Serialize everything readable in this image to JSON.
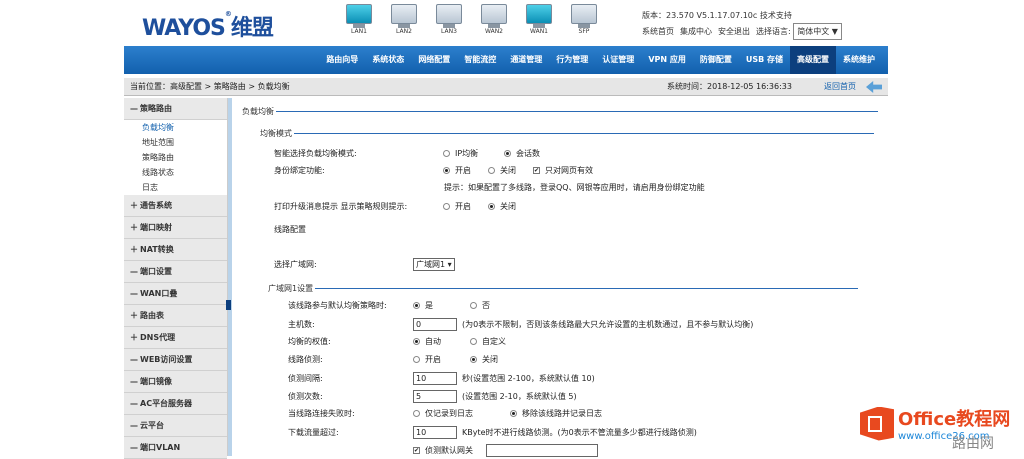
{
  "header": {
    "logo": "WAYOS",
    "logo_tm": "®",
    "logo_cn": "维盟",
    "ports": [
      {
        "label": "LAN1",
        "active": true
      },
      {
        "label": "LAN2",
        "active": false
      },
      {
        "label": "LAN3",
        "active": false
      },
      {
        "label": "WAN2",
        "active": false
      },
      {
        "label": "WAN1",
        "active": true
      },
      {
        "label": "SFP",
        "active": false
      }
    ],
    "version": "版本：23.570 V5.1.17.07.10c",
    "tech_support": "技术支持",
    "links": [
      "系统首页",
      "集成中心",
      "安全退出",
      "选择语言:"
    ],
    "language": "简体中文 ▼"
  },
  "nav": {
    "items": [
      "路由向导",
      "系统状态",
      "网络配置",
      "智能流控",
      "通道管理",
      "行为管理",
      "认证管理",
      "VPN 应用",
      "防御配置",
      "USB 存储",
      "高级配置",
      "系统维护"
    ],
    "active_index": 10
  },
  "crumb": {
    "path": "当前位置：高级配置 > 策略路由 > 负载均衡",
    "time": "系统时间：2018-12-05  16:36:33",
    "back": "返回首页"
  },
  "sidebar": {
    "groups": [
      {
        "sign": "—",
        "label": "策略路由",
        "expanded": true,
        "subs": [
          "负载均衡",
          "地址范围",
          "策略路由",
          "线路状态",
          "日志"
        ]
      },
      {
        "sign": "＋",
        "label": "通告系统"
      },
      {
        "sign": "＋",
        "label": "端口映射"
      },
      {
        "sign": "＋",
        "label": "NAT转换"
      },
      {
        "sign": "—",
        "label": "端口设置"
      },
      {
        "sign": "—",
        "label": "WAN口叠"
      },
      {
        "sign": "＋",
        "label": "路由表"
      },
      {
        "sign": "＋",
        "label": "DNS代理"
      },
      {
        "sign": "—",
        "label": "WEB访问设置"
      },
      {
        "sign": "—",
        "label": "端口镜像"
      },
      {
        "sign": "—",
        "label": "AC平台服务器"
      },
      {
        "sign": "—",
        "label": "云平台"
      },
      {
        "sign": "—",
        "label": "端口VLAN"
      }
    ],
    "current_sub": "负载均衡"
  },
  "main": {
    "section_title": "负载均衡",
    "mode": {
      "legend": "均衡模式",
      "smart_label": "智能选择负载均衡模式:",
      "smart_opts": [
        "IP均衡",
        "会话数"
      ],
      "smart_selected": 1,
      "bind_label": "身份绑定功能:",
      "bind_opts": [
        "开启",
        "关闭"
      ],
      "bind_selected": 0,
      "bind_check": "只对网页有效",
      "hint": "提示：如果配置了多线路，登录QQ、网银等应用时，请启用身份绑定功能",
      "tip_label": "打印升级消息提示   显示策略规则提示:",
      "tip_opts": [
        "开启",
        "关闭"
      ],
      "tip_selected": 1,
      "line_config": "线路配置"
    },
    "select_wan_label": "选择广域网:",
    "select_wan_value": "广域网1 ▾",
    "wan": {
      "legend": "广域网1设置",
      "multi_label": "该线路参与默认均衡策略时:",
      "multi_opts": [
        "是",
        "否"
      ],
      "multi_selected": 0,
      "hosts_label": "主机数:",
      "hosts_value": "0",
      "hosts_hint": "(为0表示不限制，否则该条线路最大只允许设置的主机数通过，且不参与默认均衡)",
      "weight_label": "均衡的权值:",
      "weight_opts": [
        "自动",
        "自定义"
      ],
      "weight_selected": 0,
      "detect_label": "线路侦测:",
      "detect_opts": [
        "开启",
        "关闭"
      ],
      "detect_selected": 1,
      "interval_label": "侦测间隔:",
      "interval_value": "10",
      "interval_hint": "秒(设置范围 2-100，系统默认值 10)",
      "count_label": "侦测次数:",
      "count_value": "5",
      "count_hint": "(设置范围 2-10，系统默认值 5)",
      "drop_label": "当线路连接失败时:",
      "drop_opts": [
        "仅记录到日志",
        "移除该线路并记录日志"
      ],
      "drop_selected": 1,
      "traffic_label": "下载流量超过:",
      "traffic_value": "10",
      "traffic_hint": "KByte时不进行线路侦测。(为0表示不管流量多少都进行线路侦测)",
      "bottom_check": "侦测默认网关"
    }
  },
  "watermark": {
    "brand": "Office教程网",
    "url": "www.office26.com",
    "corner": "路由网"
  }
}
